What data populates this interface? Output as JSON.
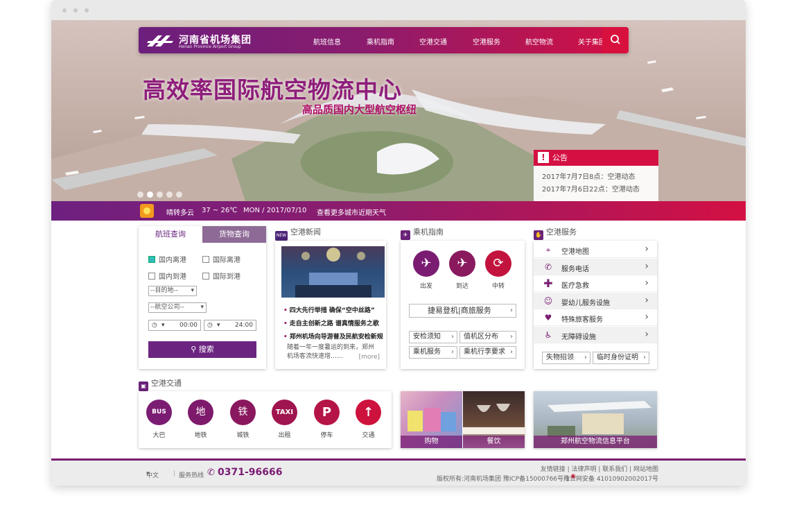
{
  "header": {
    "logo_cn": "河南省机场集团",
    "logo_en": "Henan Province Airport Group",
    "nav": [
      "航班信息",
      "乘机指南",
      "空港交通",
      "空港服务",
      "航空物流",
      "关于集团"
    ]
  },
  "banner": {
    "slogan_main": "高效率国际航空物流中心",
    "slogan_sub": "高品质国内大型航空枢纽",
    "slide_count": 5,
    "active_slide": 2
  },
  "notice": {
    "title": "公告",
    "items": [
      "2017年7月7日8点：空港动态",
      "2017年7月6日22点：空港动态"
    ]
  },
  "weather": {
    "condition": "晴转多云",
    "temp": "37 ~ 26℃",
    "date": "MON / 2017/07/10",
    "more_link": "查看更多城市近期天气"
  },
  "flight_query": {
    "tabs": [
      "航班查询",
      "货物查询"
    ],
    "options": [
      "国内离港",
      "国际离港",
      "国内到港",
      "国际到港"
    ],
    "destination": "--目的地--",
    "airline": "--航空公司--",
    "time_from": "00:00",
    "time_to": "24:00",
    "search_label": "搜索"
  },
  "news": {
    "badge": "NEW",
    "title": "空港新闻",
    "items": [
      "四大先行举措 确保“空中丝路”",
      "走自主创新之路 谱真情服务之歌",
      "郑州机场向导游普及民航安检新规"
    ],
    "excerpt": "随着一年一度暑运的到来，郑州机场客流快速增……",
    "more": "[more]"
  },
  "guide": {
    "title": "乘机指南",
    "circles": [
      "出发",
      "到达",
      "中转"
    ],
    "main_button": "捷易登机|商旅服务",
    "buttons": [
      "安检须知",
      "值机区分布",
      "乘机服务",
      "乘机行李要求"
    ]
  },
  "services": {
    "title": "空港服务",
    "items": [
      "空港地图",
      "服务电话",
      "医疗急救",
      "婴幼儿服务设施",
      "特殊旅客服务",
      "无障碍设施"
    ],
    "buttons": [
      "失物招领",
      "临时身份证明"
    ]
  },
  "transport": {
    "title": "空港交通",
    "items": [
      "大巴",
      "地铁",
      "城铁",
      "出租",
      "停车",
      "交通"
    ],
    "icons": [
      "BUS",
      "地",
      "铁",
      "TAXI",
      "P",
      "↑"
    ]
  },
  "promo": {
    "shopping": "购物",
    "dining": "餐饮",
    "logistics": "郑州航空物流信息平台"
  },
  "footer": {
    "language": "中文",
    "hotline_label": "服务热线",
    "hotline": "0371-96666",
    "links": "友情链接 | 法律声明 | 联系我们 | 网站地图",
    "copyright": "版权所有:河南机场集团 豫ICP备15000766号-1",
    "police": "豫公网安备 41010902002017号"
  }
}
